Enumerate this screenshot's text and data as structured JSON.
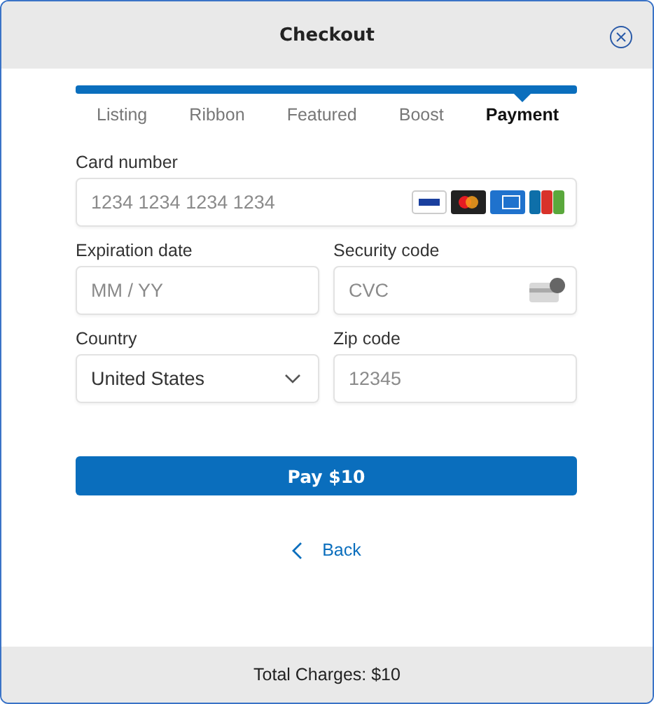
{
  "window": {
    "title": "Checkout"
  },
  "steps": [
    {
      "label": "Listing",
      "selected": false
    },
    {
      "label": "Ribbon",
      "selected": false
    },
    {
      "label": "Featured",
      "selected": false
    },
    {
      "label": "Boost",
      "selected": false
    },
    {
      "label": "Payment",
      "selected": true
    }
  ],
  "form": {
    "card_number": {
      "label": "Card number",
      "placeholder": "1234 1234 1234 1234"
    },
    "expiration": {
      "label": "Expiration date",
      "placeholder": "MM / YY"
    },
    "security_code": {
      "label": "Security code",
      "placeholder": "CVC"
    },
    "country": {
      "label": "Country",
      "value": "United States"
    },
    "zip": {
      "label": "Zip code",
      "placeholder": "12345"
    }
  },
  "pay_button": "Pay $10",
  "back_link": "Back",
  "footer": "Total Charges: $10"
}
